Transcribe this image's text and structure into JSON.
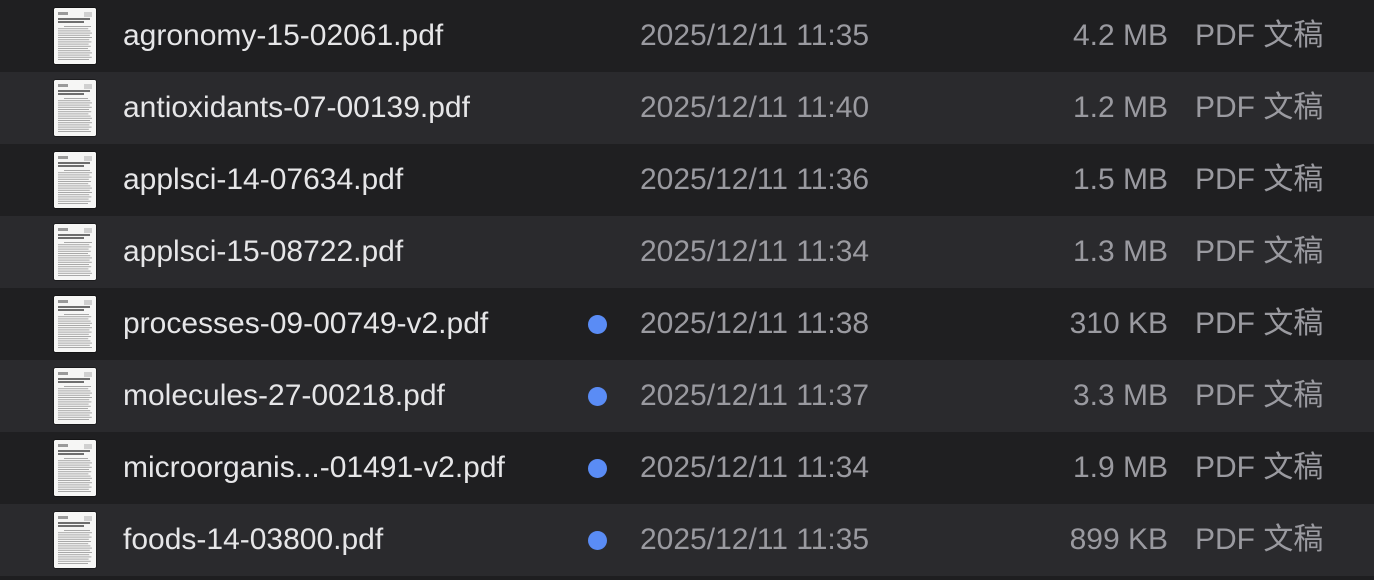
{
  "colors": {
    "tag_blue": "#5a8cf5"
  },
  "files": [
    {
      "name": "agronomy-15-02061.pdf",
      "tag": "",
      "date": "2025/12/11 11:35",
      "size": "4.2 MB",
      "kind": "PDF 文稿",
      "icon": "pdf-document-icon"
    },
    {
      "name": "antioxidants-07-00139.pdf",
      "tag": "",
      "date": "2025/12/11 11:40",
      "size": "1.2 MB",
      "kind": "PDF 文稿",
      "icon": "pdf-document-icon"
    },
    {
      "name": "applsci-14-07634.pdf",
      "tag": "",
      "date": "2025/12/11 11:36",
      "size": "1.5 MB",
      "kind": "PDF 文稿",
      "icon": "pdf-document-icon"
    },
    {
      "name": "applsci-15-08722.pdf",
      "tag": "",
      "date": "2025/12/11 11:34",
      "size": "1.3 MB",
      "kind": "PDF 文稿",
      "icon": "pdf-document-icon"
    },
    {
      "name": "processes-09-00749-v2.pdf",
      "tag": "blue",
      "date": "2025/12/11 11:38",
      "size": "310 KB",
      "kind": "PDF 文稿",
      "icon": "pdf-document-icon"
    },
    {
      "name": "molecules-27-00218.pdf",
      "tag": "blue",
      "date": "2025/12/11 11:37",
      "size": "3.3 MB",
      "kind": "PDF 文稿",
      "icon": "pdf-document-icon"
    },
    {
      "name": "microorganis...-01491-v2.pdf",
      "tag": "blue",
      "date": "2025/12/11 11:34",
      "size": "1.9 MB",
      "kind": "PDF 文稿",
      "icon": "pdf-document-icon"
    },
    {
      "name": "foods-14-03800.pdf",
      "tag": "blue",
      "date": "2025/12/11 11:35",
      "size": "899 KB",
      "kind": "PDF 文稿",
      "icon": "pdf-document-icon"
    }
  ]
}
